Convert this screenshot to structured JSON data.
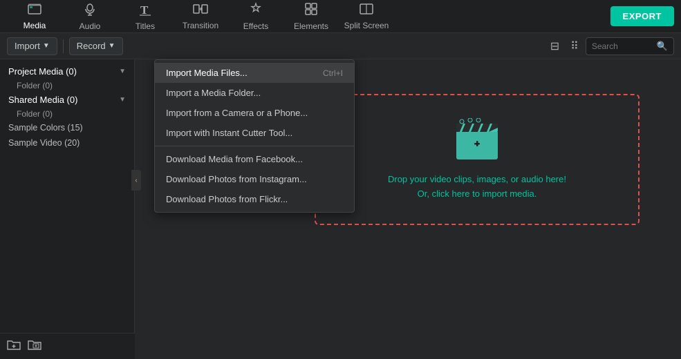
{
  "nav": {
    "items": [
      {
        "id": "media",
        "label": "Media",
        "icon": "🎬",
        "active": true
      },
      {
        "id": "audio",
        "label": "Audio",
        "icon": "🎵"
      },
      {
        "id": "titles",
        "label": "Titles",
        "icon": "T"
      },
      {
        "id": "transition",
        "label": "Transition",
        "icon": "↔"
      },
      {
        "id": "effects",
        "label": "Effects",
        "icon": "✦"
      },
      {
        "id": "elements",
        "label": "Elements",
        "icon": "⊞"
      },
      {
        "id": "split_screen",
        "label": "Split Screen",
        "icon": "⊡"
      }
    ],
    "export_label": "EXPORT"
  },
  "toolbar": {
    "import_label": "Import",
    "record_label": "Record",
    "search_placeholder": "Search"
  },
  "sidebar": {
    "project_media": "Project Media (0)",
    "project_folder": "Folder (0)",
    "shared_media": "Shared Media (0)",
    "shared_folder": "Folder (0)",
    "sample_colors": "Sample Colors (15)",
    "sample_video": "Sample Video (20)"
  },
  "dropdown": {
    "items": [
      {
        "label": "Import Media Files...",
        "shortcut": "Ctrl+I",
        "highlighted": true
      },
      {
        "label": "Import a Media Folder...",
        "shortcut": ""
      },
      {
        "label": "Import from a Camera or a Phone...",
        "shortcut": ""
      },
      {
        "label": "Import with Instant Cutter Tool...",
        "shortcut": ""
      },
      {
        "separator": true
      },
      {
        "label": "Download Media from Facebook...",
        "shortcut": ""
      },
      {
        "label": "Download Photos from Instagram...",
        "shortcut": ""
      },
      {
        "label": "Download Photos from Flickr...",
        "shortcut": ""
      }
    ]
  },
  "drop_zone": {
    "line1": "Drop your video clips, images, or audio here!",
    "line2": "Or, click here to import media."
  }
}
